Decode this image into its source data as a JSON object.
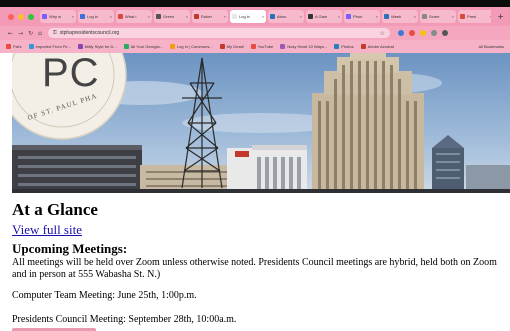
{
  "browser": {
    "tabs": [
      {
        "title": "Why is",
        "fav": "#7a5cff",
        "active": false
      },
      {
        "title": "Log in",
        "fav": "#3b6fd8",
        "active": false
      },
      {
        "title": "What i",
        "fav": "#d94a3b",
        "active": false
      },
      {
        "title": "Green",
        "fav": "#555555",
        "active": false
      },
      {
        "title": "Rober",
        "fav": "#c0392b",
        "active": false
      },
      {
        "title": "Log in",
        "fav": "#e8e8e8",
        "active": true
      },
      {
        "title": "Abou",
        "fav": "#2c6fbb",
        "active": false
      },
      {
        "title": "A Gam",
        "fav": "#333333",
        "active": false
      },
      {
        "title": "Phon",
        "fav": "#7a5cff",
        "active": false
      },
      {
        "title": "Week",
        "fav": "#2c6fbb",
        "active": false
      },
      {
        "title": "Scree",
        "fav": "#888888",
        "active": false
      },
      {
        "title": "Presi",
        "fav": "#d94a3b",
        "active": false
      }
    ],
    "new_tab_icon": "+",
    "url": "stphapresidentscouncil.org",
    "bookmarks": [
      {
        "label": "Pal's",
        "color": "#e74c3c"
      },
      {
        "label": "Imported From Fir...",
        "color": "#3498db"
      },
      {
        "label": "Mlilly Style for D...",
        "color": "#8e44ad"
      },
      {
        "label": "All Your Georgia...",
        "color": "#27ae60"
      },
      {
        "label": "Log in | Commons...",
        "color": "#f39c12"
      },
      {
        "label": "My Gmail",
        "color": "#c0392b"
      },
      {
        "label": "YouTube",
        "color": "#e74c3c"
      },
      {
        "label": "Nosy Heart 10 Ways...",
        "color": "#9b59b6"
      },
      {
        "label": "Photos",
        "color": "#2980b9"
      },
      {
        "label": "Adobe Acrobat",
        "color": "#c0392b"
      }
    ],
    "all_bookmarks": "All Bookmarks"
  },
  "hero": {
    "logo_initials": "PC",
    "logo_ring_text": "OF ST. PAUL PHA"
  },
  "page": {
    "heading": "At a Glance",
    "view_full_site": "View full site",
    "upcoming_heading": "Upcoming Meetings:",
    "note": "All meetings will be held over Zoom unless otherwise noted. Presidents Council meetings are hybrid, held both on Zoom and in person at 555 Wabasha St. N.)",
    "computer_team": "Computer Team Meeting: June 25th, 1:00p.m.",
    "presidents_council": "Presidents Council Meeting: September 28th, 10:00a.m."
  }
}
